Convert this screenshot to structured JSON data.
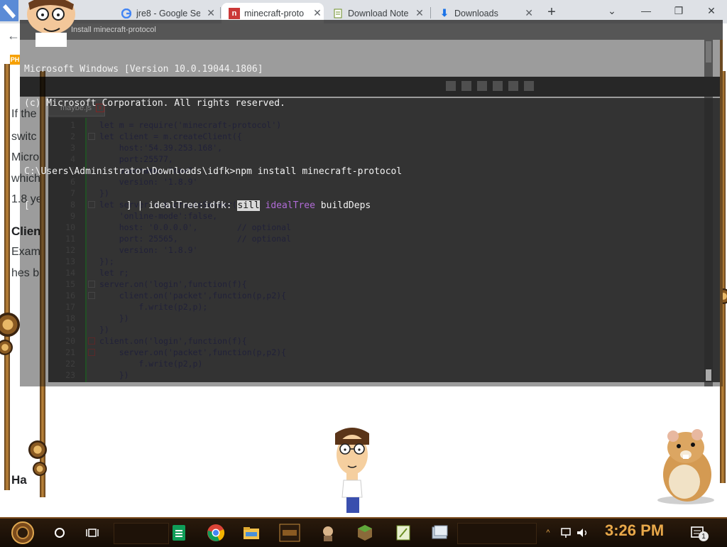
{
  "browser": {
    "tabs": [
      {
        "label": "jre8 - Google Se",
        "icon": "google-icon",
        "active": false
      },
      {
        "label": "minecraft-proto",
        "icon": "npm-icon",
        "active": true
      },
      {
        "label": "Download Note",
        "icon": "notepad-icon",
        "active": false
      },
      {
        "label": "Downloads",
        "icon": "download-icon",
        "active": false
      }
    ],
    "new_tab": "+",
    "controls": {
      "dropdown": "⌄",
      "minimize": "—",
      "restore": "❐",
      "close": "✕"
    }
  },
  "page": {
    "badge": "PH",
    "fragments": [
      "If the",
      "switc",
      "Micro",
      "which",
      "1.8 ye",
      "Clien",
      "Exam",
      "hes b",
      "Ha"
    ]
  },
  "cmd": {
    "title": "Install minecraft-protocol",
    "lines": [
      "Microsoft Windows [Version 10.0.19044.1806]",
      "(c) Microsoft Corporation. All rights reserved.",
      "",
      "C:\\Users\\Administrator\\Downloads\\idfk>npm install minecraft-protocol"
    ],
    "progress": {
      "prefix": "[",
      "suffix": "] | idealTree:idfk: ",
      "sill": "sill",
      "purple": "idealTree",
      "rest": " buildDeps"
    }
  },
  "editor": {
    "tab_label": "maybe.js",
    "lines": [
      {
        "n": "1",
        "t": "let m = require('minecraft-protocol')"
      },
      {
        "n": "2",
        "t": "let client = m.createClient({"
      },
      {
        "n": "3",
        "t": "    host:'54.39.253.168',"
      },
      {
        "n": "4",
        "t": "    port:25577,"
      },
      {
        "n": "5",
        "t": "    username: \"cow\","
      },
      {
        "n": "6",
        "t": "    version: '1.8.9'"
      },
      {
        "n": "7",
        "t": "})"
      },
      {
        "n": "8",
        "t": "let server = m.createServer({"
      },
      {
        "n": "9",
        "t": "    'online-mode':false,"
      },
      {
        "n": "10",
        "t": "    host: '0.0.0.0',        // optional"
      },
      {
        "n": "11",
        "t": "    port: 25565,            // optional"
      },
      {
        "n": "12",
        "t": "    version: '1.8.9'"
      },
      {
        "n": "13",
        "t": "});"
      },
      {
        "n": "14",
        "t": "let r;"
      },
      {
        "n": "15",
        "t": "server.on('login',function(f){"
      },
      {
        "n": "16",
        "t": "    client.on('packet',function(p,p2){"
      },
      {
        "n": "17",
        "t": "        f.write(p2,p);"
      },
      {
        "n": "18",
        "t": "    })"
      },
      {
        "n": "19",
        "t": "})"
      },
      {
        "n": "20",
        "t": "client.on('login',function(f){"
      },
      {
        "n": "21",
        "t": "    server.on('packet',function(p,p2){"
      },
      {
        "n": "22",
        "t": "        f.write(p2,p)"
      },
      {
        "n": "23",
        "t": "    })"
      },
      {
        "n": "24",
        "t": "})"
      }
    ]
  },
  "taskbar": {
    "clock": "3:26 PM",
    "notification_count": "1"
  },
  "colors": {
    "accent_clock": "#e8a84a",
    "taskbar_bg": "#1a0f06",
    "gear": "#c48a3c"
  }
}
